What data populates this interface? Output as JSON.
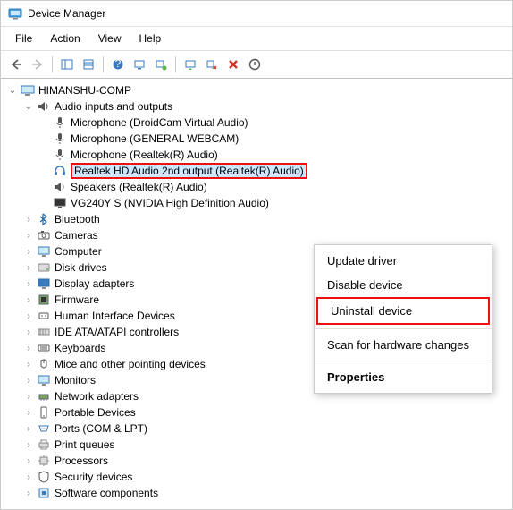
{
  "window": {
    "title": "Device Manager"
  },
  "menu": {
    "file": "File",
    "action": "Action",
    "view": "View",
    "help": "Help"
  },
  "root": "HIMANSHU-COMP",
  "audio": {
    "label": "Audio inputs and outputs",
    "items": [
      "Microphone (DroidCam Virtual Audio)",
      "Microphone (GENERAL WEBCAM)",
      "Microphone (Realtek(R) Audio)",
      "Realtek HD Audio 2nd output (Realtek(R) Audio)",
      "Speakers (Realtek(R) Audio)",
      "VG240Y S (NVIDIA High Definition Audio)"
    ]
  },
  "categories": [
    "Bluetooth",
    "Cameras",
    "Computer",
    "Disk drives",
    "Display adapters",
    "Firmware",
    "Human Interface Devices",
    "IDE ATA/ATAPI controllers",
    "Keyboards",
    "Mice and other pointing devices",
    "Monitors",
    "Network adapters",
    "Portable Devices",
    "Ports (COM & LPT)",
    "Print queues",
    "Processors",
    "Security devices",
    "Software components"
  ],
  "context": {
    "update": "Update driver",
    "disable": "Disable device",
    "uninstall": "Uninstall device",
    "scan": "Scan for hardware changes",
    "properties": "Properties"
  }
}
